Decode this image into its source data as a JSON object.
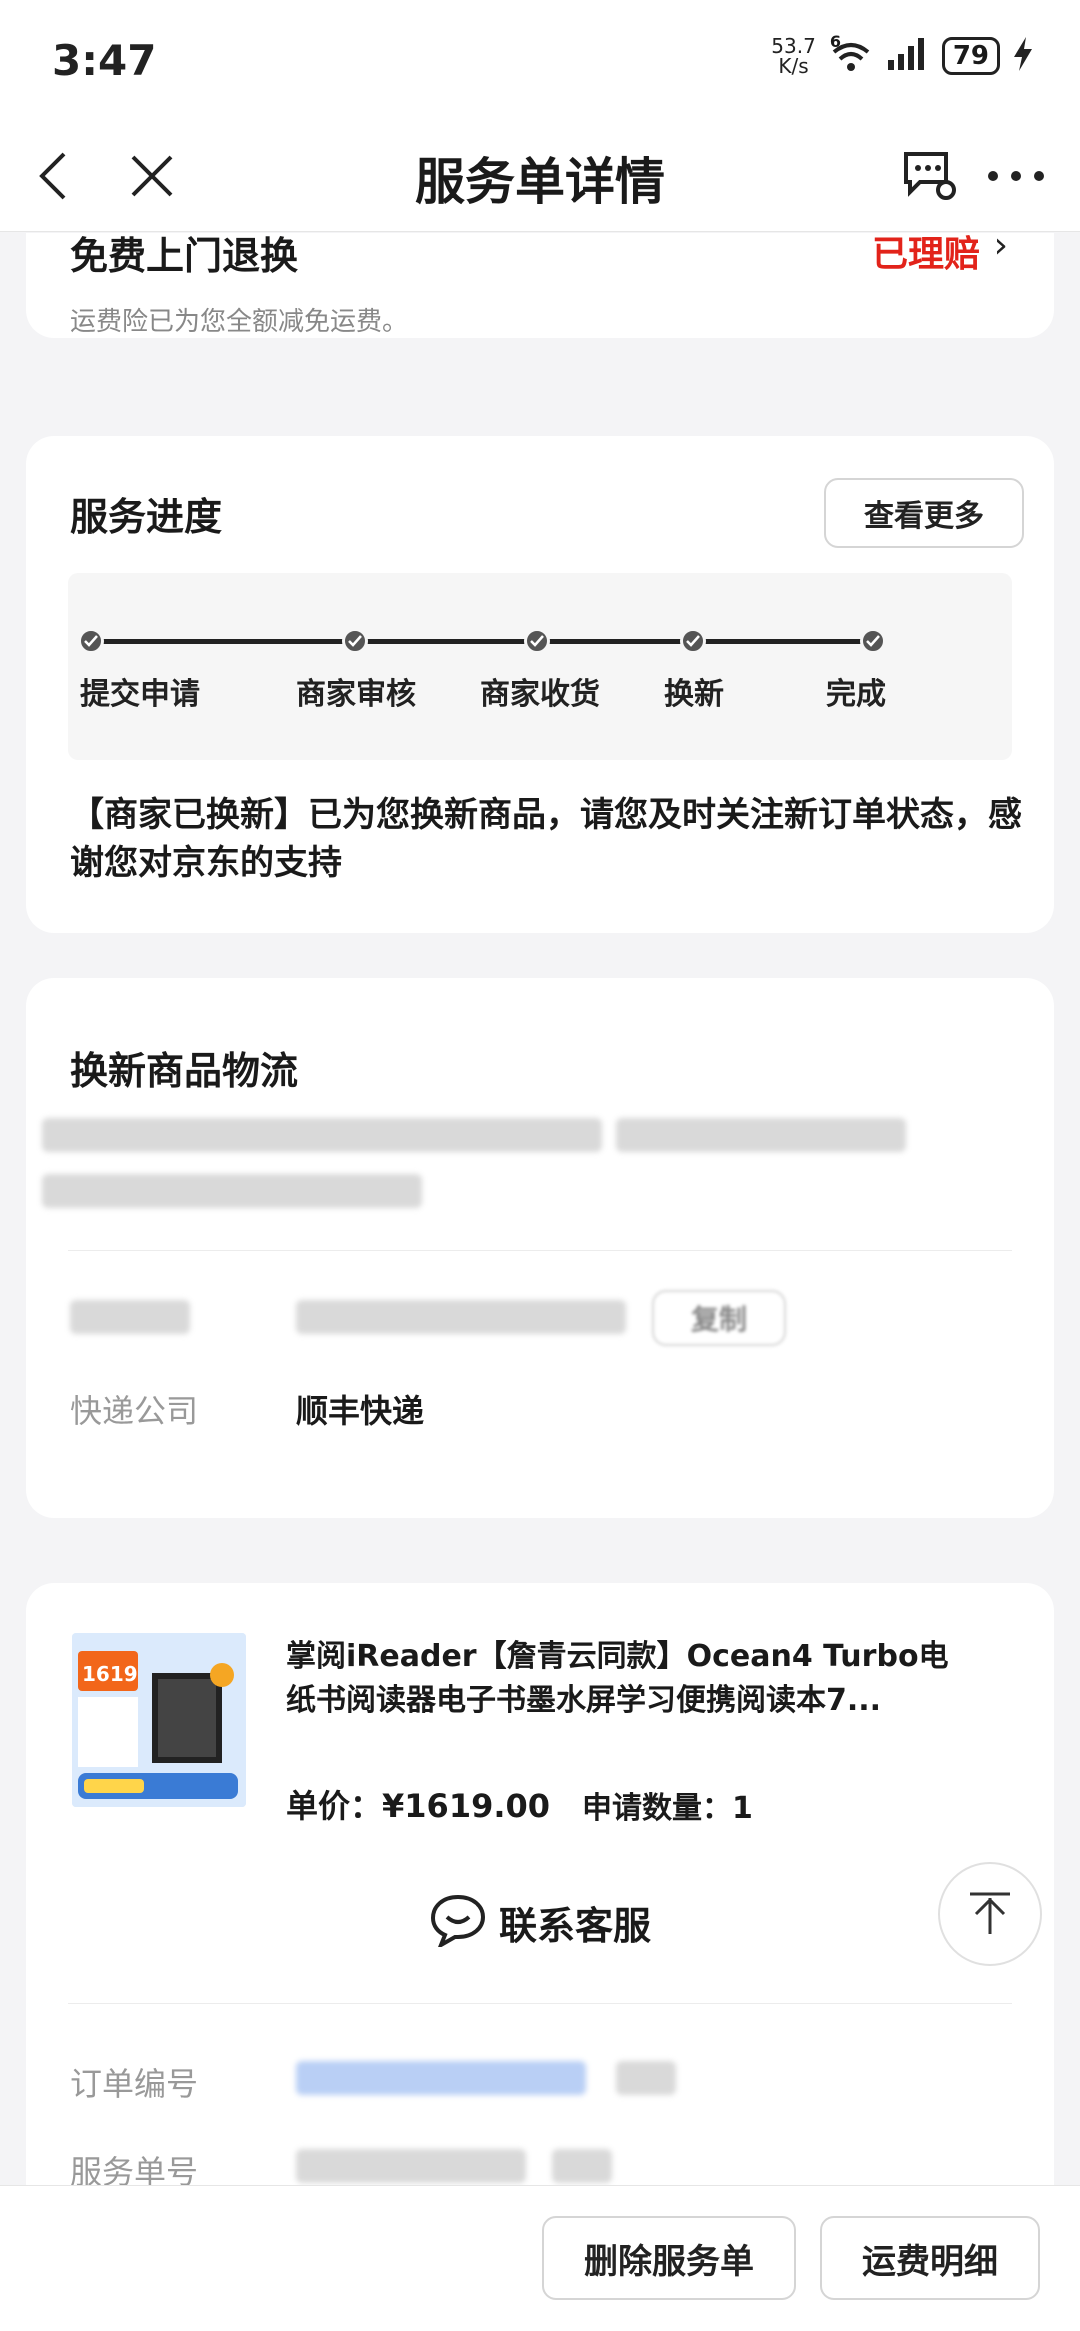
{
  "status_bar": {
    "time": "3:47",
    "net_speed_value": "53.7",
    "net_speed_unit": "K/s",
    "network_type": "6",
    "battery": "79"
  },
  "nav": {
    "title": "服务单详情"
  },
  "return_card": {
    "title": "免费上门退换",
    "status": "已理赔",
    "desc": "运费险已为您全额减免运费。"
  },
  "progress": {
    "title": "服务进度",
    "more_label": "查看更多",
    "steps": [
      "提交申请",
      "商家审核",
      "商家收货",
      "换新",
      "完成"
    ],
    "note": "【商家已换新】已为您换新商品，请您及时关注新订单状态，感谢您对京东的支持"
  },
  "logistics": {
    "title": "换新商品物流",
    "copy_label": "复制",
    "courier_label": "快递公司",
    "courier_value": "顺丰快递"
  },
  "product": {
    "name": "掌阅iReader【詹青云同款】Ocean4 Turbo电纸书阅读器电子书墨水屏学习便携阅读本7...",
    "price_label": "单价：",
    "price": "¥1619.00",
    "qty_label": "申请数量：",
    "qty": "1",
    "image_badge_price": "1619"
  },
  "service": {
    "contact_label": "联系客服",
    "order_no_label": "订单编号",
    "service_no_label": "服务单号"
  },
  "bottom": {
    "delete_label": "删除服务单",
    "freight_label": "运费明细"
  },
  "colors": {
    "accent_red": "#e2231a",
    "bg": "#f4f4f6",
    "card": "#ffffff"
  }
}
